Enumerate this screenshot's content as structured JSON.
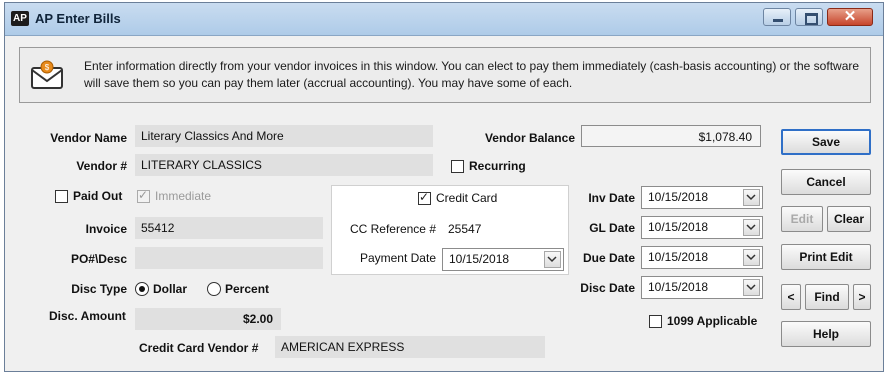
{
  "window": {
    "app_icon_text": "AP",
    "title": "AP Enter Bills"
  },
  "info": {
    "icon": "mail-icon",
    "message": "Enter information directly from your vendor invoices in this window. You can elect to pay them immediately (cash-basis accounting) or the software will save them so you can pay them later (accrual accounting). You may have some of each."
  },
  "form": {
    "vendor_name_label": "Vendor Name",
    "vendor_name_value": "Literary Classics And More",
    "vendor_balance_label": "Vendor Balance",
    "vendor_balance_value": "$1,078.40",
    "vendor_num_label": "Vendor #",
    "vendor_num_value": "LITERARY CLASSICS",
    "recurring_label": "Recurring",
    "recurring_checked": false,
    "paid_out_label": "Paid Out",
    "paid_out_checked": false,
    "immediate_label": "Immediate",
    "immediate_checked": true,
    "invoice_label": "Invoice",
    "invoice_value": "55412",
    "po_desc_label": "PO#\\Desc",
    "po_desc_value": "",
    "disc_type_label": "Disc Type",
    "disc_type_options": [
      "Dollar",
      "Percent"
    ],
    "disc_type_selected": "Dollar",
    "disc_amount_label": "Disc. Amount",
    "disc_amount_value": "$2.00",
    "cc_vendor_label": "Credit Card Vendor #",
    "cc_vendor_value": "AMERICAN EXPRESS",
    "applicable_1099_label": "1099 Applicable",
    "applicable_1099_checked": false
  },
  "credit_card": {
    "checkbox_label": "Credit Card",
    "checked": true,
    "cc_reference_label": "CC Reference #",
    "cc_reference_value": "25547",
    "payment_date_label": "Payment Date",
    "payment_date_value": "10/15/2018"
  },
  "dates": {
    "inv_date_label": "Inv Date",
    "inv_date_value": "10/15/2018",
    "gl_date_label": "GL Date",
    "gl_date_value": "10/15/2018",
    "due_date_label": "Due Date",
    "due_date_value": "10/15/2018",
    "disc_date_label": "Disc Date",
    "disc_date_value": "10/15/2018"
  },
  "buttons": {
    "save": "Save",
    "cancel": "Cancel",
    "edit": "Edit",
    "clear": "Clear",
    "print_edit": "Print Edit",
    "prev": "<",
    "find": "Find",
    "next": ">",
    "help": "Help"
  },
  "colors": {
    "titlebar": "#aecbe8",
    "close_button": "#c6452b",
    "primary_button_border": "#2f6fc7"
  }
}
